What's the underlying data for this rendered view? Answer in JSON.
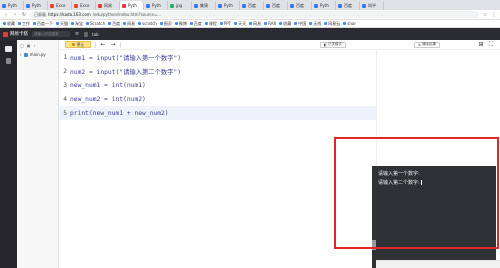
{
  "browser": {
    "tabs": [
      {
        "label": "Pyth",
        "color": "#3b78e7"
      },
      {
        "label": "Pyth",
        "color": "#3b78e7"
      },
      {
        "label": "Exce",
        "color": "#e8452c"
      },
      {
        "label": "Exce",
        "color": "#e8452c"
      },
      {
        "label": "网易",
        "color": "#e33b3b"
      },
      {
        "label": "Pyth",
        "color": "#e33b3b",
        "active": true
      },
      {
        "label": "Pyth",
        "color": "#3b78e7"
      },
      {
        "label": "jpg",
        "color": "#33aa66"
      },
      {
        "label": "集锦",
        "color": "#3b78e7"
      },
      {
        "label": "Pyth",
        "color": "#3b78e7"
      },
      {
        "label": "百度",
        "color": "#3b78e7"
      },
      {
        "label": "百度",
        "color": "#3b78e7"
      },
      {
        "label": "百度",
        "color": "#3b78e7"
      },
      {
        "label": "Pyth",
        "color": "#3b78e7"
      },
      {
        "label": "百度",
        "color": "#3b78e7"
      },
      {
        "label": "知乎",
        "color": "#3b78e7"
      }
    ],
    "url_prefix": "已屏蔽",
    "url_host": "https://kada.163.com",
    "url_path": "/edu/python/index.htm?source=...",
    "bookmarks": [
      "收藏",
      "工作",
      "百度一下",
      "天猫",
      "淘宝",
      "Scratch",
      "百度",
      "网易",
      "scratch",
      "图灵",
      "微博",
      "百度",
      "课程",
      "PPT",
      "天天",
      "网易",
      "RAR",
      "收藏",
      "中国",
      "无线",
      "网易云",
      "shar"
    ]
  },
  "app": {
    "name": "网易卡搭",
    "search_placeholder": "请输入内容搜索",
    "file_tab_label": "tab"
  },
  "sidebar": {
    "icons": [
      "folder-icon",
      "file-icon"
    ]
  },
  "filepanel": {
    "file": "main.py"
  },
  "toolbar": {
    "run_label": "停止",
    "mode_label": "已关模式",
    "clear_label": "清除结果"
  },
  "editor": {
    "lines": [
      {
        "num": "1",
        "code": "num1 = input(\"请输入第一个数字\")"
      },
      {
        "num": "2",
        "code": "num2 = input(\"请输入第二个数字\")"
      },
      {
        "num": "3",
        "code": "new_num1 = int(num1)"
      },
      {
        "num": "4",
        "code": "new_num2 = int(num2)"
      },
      {
        "num": "5",
        "code": "print(new_num1 + new_num2)",
        "current": true
      }
    ]
  },
  "terminal": {
    "lines": [
      "请输入第一个数字:",
      "请输入第二个数字:"
    ]
  }
}
